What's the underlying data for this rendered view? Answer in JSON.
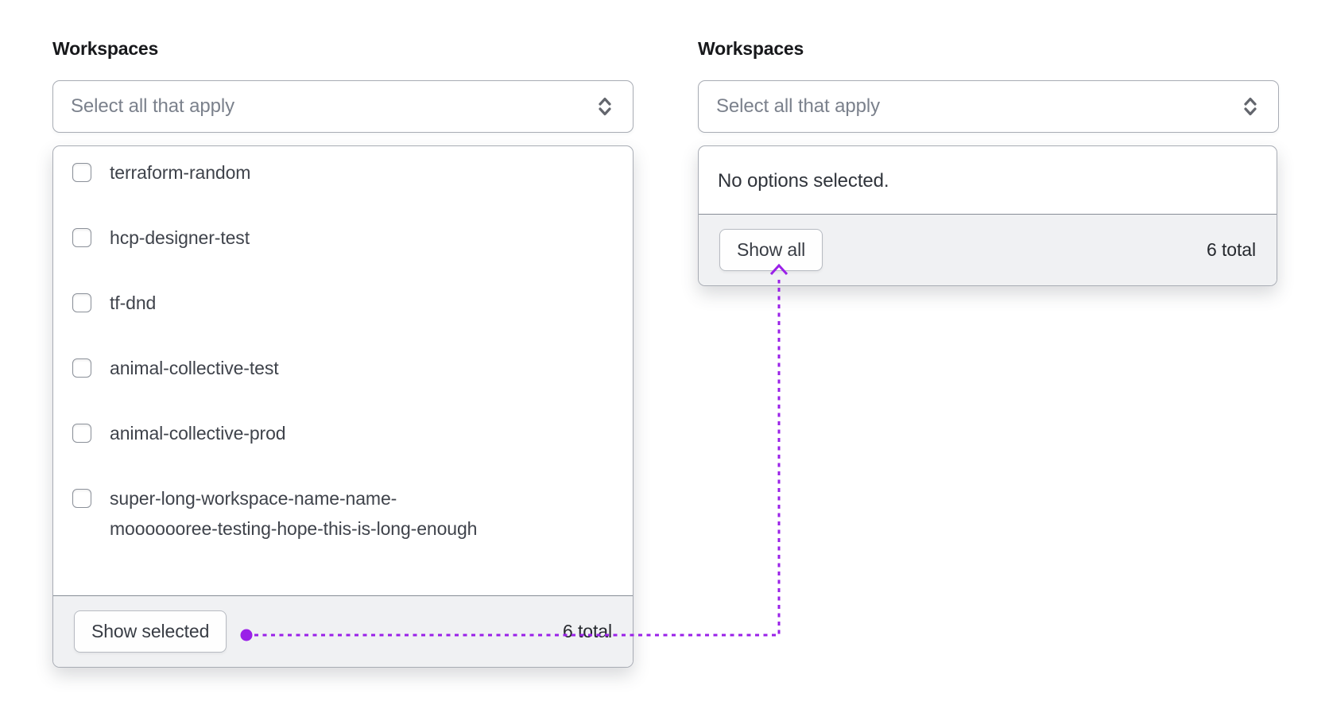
{
  "colors": {
    "annotation_purple": "#9a20e8",
    "footer_background": "#f0f1f3",
    "panel_border": "#a8acb4"
  },
  "left_combobox": {
    "label": "Workspaces",
    "placeholder": "Select all that apply",
    "caret_icon": "caret-sort-icon",
    "options": [
      {
        "checked": false,
        "lines": [
          "terraform-random"
        ]
      },
      {
        "checked": false,
        "lines": [
          "hcp-designer-test"
        ]
      },
      {
        "checked": false,
        "lines": [
          "tf-dnd"
        ]
      },
      {
        "checked": false,
        "lines": [
          "animal-collective-test"
        ]
      },
      {
        "checked": false,
        "lines": [
          "animal-collective-prod"
        ]
      },
      {
        "checked": false,
        "lines": [
          "super-long-workspace-name-name-",
          "mooooooree-testing-hope-this-is-long-enough"
        ]
      }
    ],
    "footer": {
      "button": "Show selected",
      "total": "6 total"
    }
  },
  "right_combobox": {
    "label": "Workspaces",
    "placeholder": "Select all that apply",
    "caret_icon": "caret-sort-icon",
    "empty_message": "No options selected.",
    "footer": {
      "button": "Show all",
      "total": "6 total"
    }
  }
}
